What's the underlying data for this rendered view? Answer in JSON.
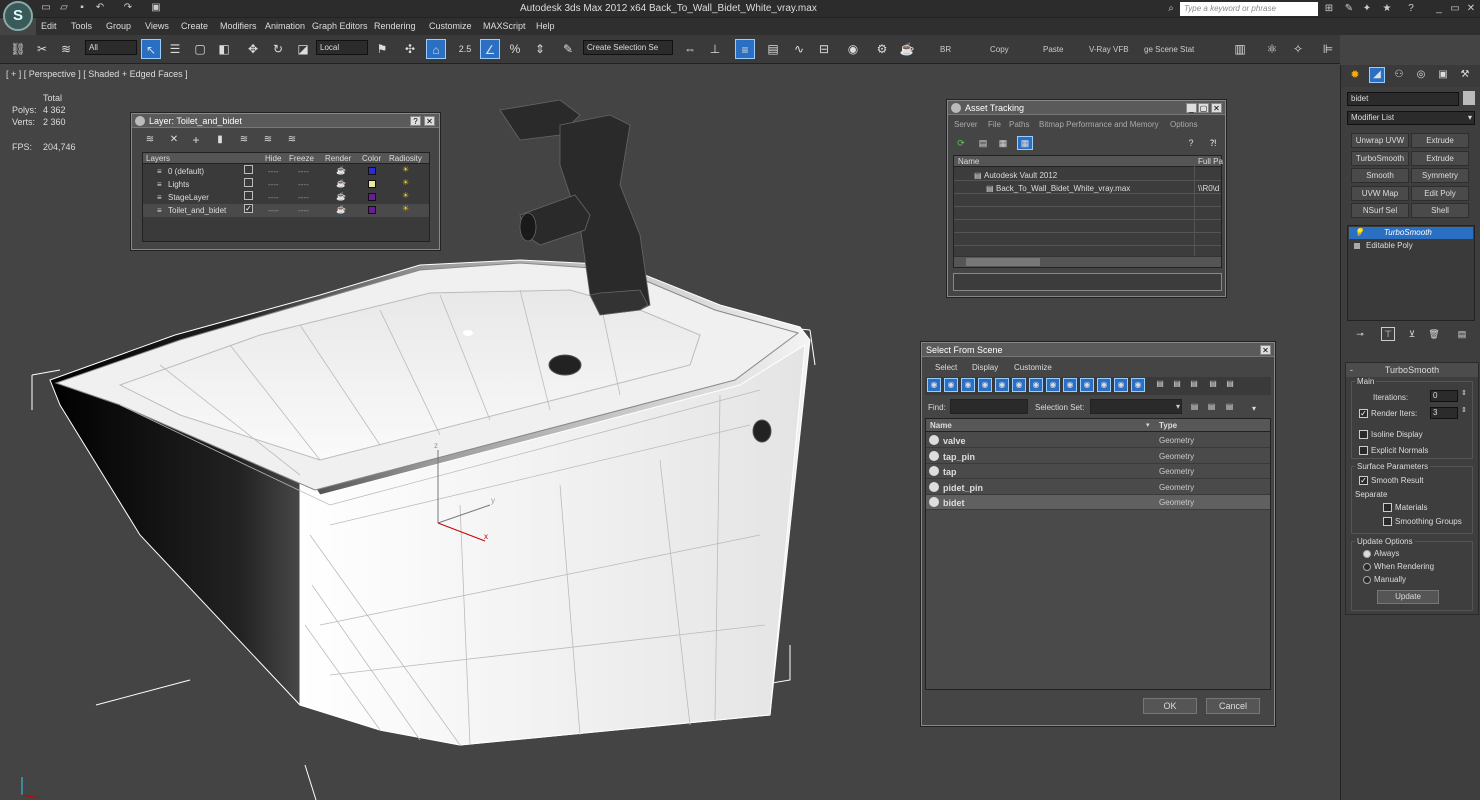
{
  "app": {
    "title": "Autodesk 3ds Max  2012 x64     Back_To_Wall_Bidet_White_vray.max",
    "search_placeholder": "Type a keyword or phrase"
  },
  "menu": [
    "Edit",
    "Tools",
    "Group",
    "Views",
    "Create",
    "Modifiers",
    "Animation",
    "Graph Editors",
    "Rendering",
    "Customize",
    "MAXScript",
    "Help"
  ],
  "toolbar": {
    "filter": "All",
    "ref_coord": "Local",
    "snap_value": "2.5",
    "selection_set": "Create Selection Se",
    "br": "BR",
    "copy": "Copy",
    "paste": "Paste",
    "vray_vfb": "V-Ray VFB",
    "manage_scene": "ge Scene Stat"
  },
  "viewport": {
    "label": "[ + ] [ Perspective ] [ Shaded + Edged Faces ]",
    "stats": {
      "header": "Total",
      "polys_label": "Polys:",
      "polys": "4 362",
      "verts_label": "Verts:",
      "verts": "2 360",
      "fps_label": "FPS:",
      "fps": "204,746"
    }
  },
  "layer_dialog": {
    "title": "Layer: Toilet_and_bidet",
    "columns": [
      "Layers",
      "Hide",
      "Freeze",
      "Render",
      "Color",
      "Radiosity"
    ],
    "rows": [
      {
        "name": "0 (default)",
        "hide": "----",
        "freeze": "----",
        "color": "#2b2bd0",
        "check": ""
      },
      {
        "name": "Lights",
        "hide": "----",
        "freeze": "----",
        "color": "#e8e8a0",
        "check": ""
      },
      {
        "name": "StageLayer",
        "hide": "----",
        "freeze": "----",
        "color": "#6a1a9a",
        "check": ""
      },
      {
        "name": "Toilet_and_bidet",
        "hide": "----",
        "freeze": "----",
        "color": "#6a1a9a",
        "check": "✓"
      }
    ]
  },
  "asset_tracking": {
    "title": "Asset Tracking",
    "menu": [
      "Server",
      "File",
      "Paths",
      "Bitmap Performance and Memory",
      "Options"
    ],
    "col_name": "Name",
    "col_path": "Full Pa",
    "rows": [
      {
        "name": "Autodesk Vault 2012",
        "path": ""
      },
      {
        "name": "Back_To_Wall_Bidet_White_vray.max",
        "path": "\\\\R0\\d"
      }
    ]
  },
  "select_from_scene": {
    "title": "Select From Scene",
    "menu": [
      "Select",
      "Display",
      "Customize"
    ],
    "find_label": "Find:",
    "selset_label": "Selection Set:",
    "col_name": "Name",
    "col_type": "Type",
    "rows": [
      {
        "name": "valve",
        "type": "Geometry"
      },
      {
        "name": "tap_pin",
        "type": "Geometry"
      },
      {
        "name": "tap",
        "type": "Geometry"
      },
      {
        "name": "pidet_pin",
        "type": "Geometry"
      },
      {
        "name": "bidet",
        "type": "Geometry"
      }
    ],
    "ok": "OK",
    "cancel": "Cancel"
  },
  "command_panel": {
    "object_name": "bidet",
    "modifier_list": "Modifier List",
    "buttons": [
      "Unwrap UVW",
      "Extrude",
      "TurboSmooth",
      "Extrude",
      "Smooth",
      "Symmetry",
      "UVW Map",
      "Edit Poly",
      "NSurf Sel",
      "Shell"
    ],
    "stack": [
      "TurboSmooth",
      "Editable Poly"
    ],
    "rollout_title": "TurboSmooth",
    "main": "Main",
    "iterations_label": "Iterations:",
    "iterations": "0",
    "render_iters_label": "Render Iters:",
    "render_iters": "3",
    "isoline": "Isoline Display",
    "explicit_normals": "Explicit Normals",
    "surface_params": "Surface Parameters",
    "smooth_result": "Smooth Result",
    "separate": "Separate",
    "materials": "Materials",
    "smoothing_groups": "Smoothing Groups",
    "update_options": "Update Options",
    "always": "Always",
    "when_rendering": "When Rendering",
    "manually": "Manually",
    "update": "Update"
  }
}
